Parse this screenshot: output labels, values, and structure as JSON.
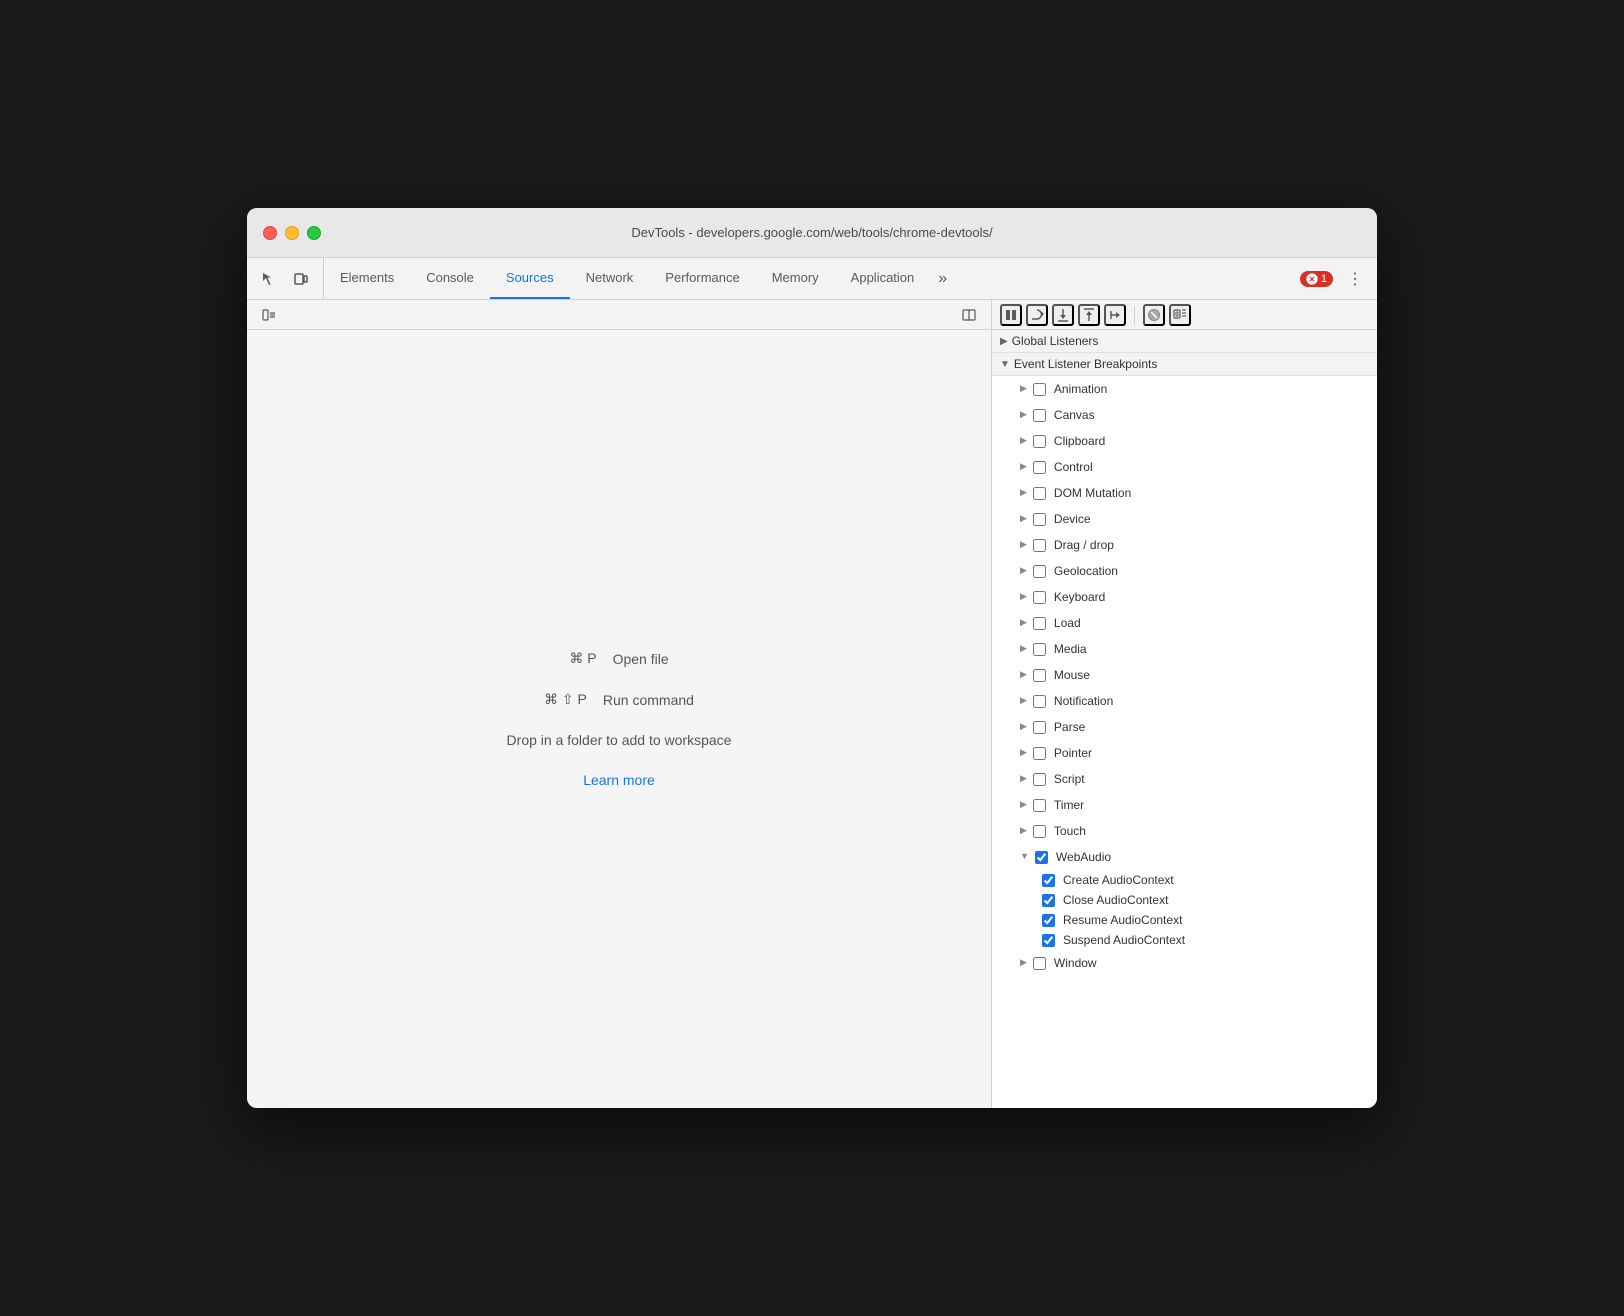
{
  "window": {
    "title": "DevTools - developers.google.com/web/tools/chrome-devtools/"
  },
  "titlebar": {
    "title": "DevTools - developers.google.com/web/tools/chrome-devtools/"
  },
  "tabs": [
    {
      "id": "elements",
      "label": "Elements",
      "active": false
    },
    {
      "id": "console",
      "label": "Console",
      "active": false
    },
    {
      "id": "sources",
      "label": "Sources",
      "active": true
    },
    {
      "id": "network",
      "label": "Network",
      "active": false
    },
    {
      "id": "performance",
      "label": "Performance",
      "active": false
    },
    {
      "id": "memory",
      "label": "Memory",
      "active": false
    },
    {
      "id": "application",
      "label": "Application",
      "active": false
    }
  ],
  "error_badge": {
    "count": "1"
  },
  "sources_panel": {
    "open_file_shortcut": "⌘ P",
    "open_file_label": "Open file",
    "run_command_shortcut": "⌘ ⇧ P",
    "run_command_label": "Run command",
    "drop_text": "Drop in a folder to add to workspace",
    "learn_more": "Learn more"
  },
  "event_listener_breakpoints": {
    "section_label": "Event Listener Breakpoints",
    "global_listeners_label": "Global Listeners",
    "items": [
      {
        "id": "animation",
        "label": "Animation",
        "checked": false,
        "expanded": false
      },
      {
        "id": "canvas",
        "label": "Canvas",
        "checked": false,
        "expanded": false
      },
      {
        "id": "clipboard",
        "label": "Clipboard",
        "checked": false,
        "expanded": false
      },
      {
        "id": "control",
        "label": "Control",
        "checked": false,
        "expanded": false
      },
      {
        "id": "dom-mutation",
        "label": "DOM Mutation",
        "checked": false,
        "expanded": false
      },
      {
        "id": "device",
        "label": "Device",
        "checked": false,
        "expanded": false
      },
      {
        "id": "drag-drop",
        "label": "Drag / drop",
        "checked": false,
        "expanded": false
      },
      {
        "id": "geolocation",
        "label": "Geolocation",
        "checked": false,
        "expanded": false
      },
      {
        "id": "keyboard",
        "label": "Keyboard",
        "checked": false,
        "expanded": false
      },
      {
        "id": "load",
        "label": "Load",
        "checked": false,
        "expanded": false
      },
      {
        "id": "media",
        "label": "Media",
        "checked": false,
        "expanded": false
      },
      {
        "id": "mouse",
        "label": "Mouse",
        "checked": false,
        "expanded": false
      },
      {
        "id": "notification",
        "label": "Notification",
        "checked": false,
        "expanded": false
      },
      {
        "id": "parse",
        "label": "Parse",
        "checked": false,
        "expanded": false
      },
      {
        "id": "pointer",
        "label": "Pointer",
        "checked": false,
        "expanded": false
      },
      {
        "id": "script",
        "label": "Script",
        "checked": false,
        "expanded": false
      },
      {
        "id": "timer",
        "label": "Timer",
        "checked": false,
        "expanded": false
      },
      {
        "id": "touch",
        "label": "Touch",
        "checked": false,
        "expanded": false
      },
      {
        "id": "webaudio",
        "label": "WebAudio",
        "checked": true,
        "expanded": true,
        "children": [
          {
            "id": "create-audiocontext",
            "label": "Create AudioContext",
            "checked": true
          },
          {
            "id": "close-audiocontext",
            "label": "Close AudioContext",
            "checked": true
          },
          {
            "id": "resume-audiocontext",
            "label": "Resume AudioContext",
            "checked": true
          },
          {
            "id": "suspend-audiocontext",
            "label": "Suspend AudioContext",
            "checked": true
          }
        ]
      },
      {
        "id": "window",
        "label": "Window",
        "checked": false,
        "expanded": false
      }
    ]
  }
}
